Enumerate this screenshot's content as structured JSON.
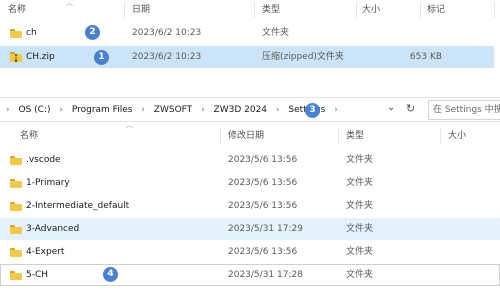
{
  "top_pane": {
    "headers": {
      "name": "名称",
      "date": "日期",
      "type": "类型",
      "size": "大小",
      "tag": "标记"
    },
    "rows": [
      {
        "name": "ch",
        "date": "2023/6/2 10:23",
        "type": "文件夹",
        "size": "",
        "badge": "2"
      },
      {
        "name": "CH.zip",
        "date": "2023/6/2 10:23",
        "type": "压缩(zipped)文件夹",
        "size": "653 KB",
        "badge": "1"
      }
    ]
  },
  "address_bar": {
    "crumbs": [
      "OS (C:)",
      "Program Files",
      "ZWSOFT",
      "ZW3D 2024",
      "Settings"
    ],
    "badge": "3",
    "search_placeholder": "在 Settings 中搜"
  },
  "bottom_pane": {
    "headers": {
      "name": "名称",
      "modified": "修改日期",
      "type": "类型",
      "size": "大小"
    },
    "rows": [
      {
        "name": ".vscode",
        "date": "2023/5/6 13:56",
        "type": "文件夹"
      },
      {
        "name": "1-Primary",
        "date": "2023/5/6 13:56",
        "type": "文件夹"
      },
      {
        "name": "2-Intermediate_default",
        "date": "2023/5/6 13:56",
        "type": "文件夹"
      },
      {
        "name": "3-Advanced",
        "date": "2023/5/31 17:29",
        "type": "文件夹"
      },
      {
        "name": "4-Expert",
        "date": "2023/5/6 13:56",
        "type": "文件夹"
      },
      {
        "name": "5-CH",
        "date": "2023/5/31 17:28",
        "type": "文件夹",
        "badge": "4"
      }
    ]
  },
  "colors": {
    "selected": "#cce4f7",
    "hover": "#e5f3ff",
    "badge": "#4a80d0",
    "folder": "#f2c94c"
  }
}
